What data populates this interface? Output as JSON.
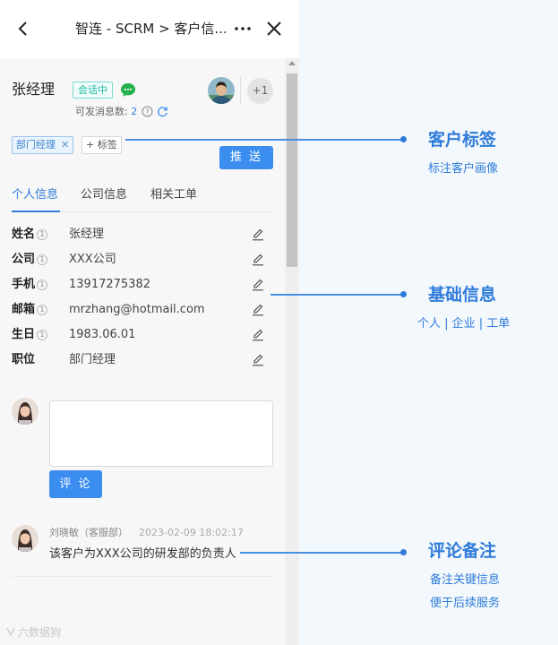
{
  "nav": {
    "title": "智连 - SCRM > 客户信..."
  },
  "customer": {
    "name": "张经理",
    "status_badge": "会话中",
    "message_count_label": "可发消息数:",
    "message_count": "2",
    "extra_members": "+1"
  },
  "tags": {
    "items": [
      {
        "label": "部门经理"
      }
    ],
    "add_label": "+ 标签",
    "push_label": "推 送"
  },
  "tabs": [
    {
      "label": "个人信息"
    },
    {
      "label": "公司信息"
    },
    {
      "label": "相关工单"
    }
  ],
  "fields": [
    {
      "label": "姓名",
      "badge": "1",
      "value": "张经理"
    },
    {
      "label": "公司",
      "badge": "1",
      "value": "XXX公司"
    },
    {
      "label": "手机",
      "badge": "1",
      "value": "13917275382"
    },
    {
      "label": "邮箱",
      "badge": "1",
      "value": "mrzhang@hotmail.com"
    },
    {
      "label": "生日",
      "badge": "1",
      "value": "1983.06.01"
    },
    {
      "label": "职位",
      "badge": "",
      "value": "部门经理"
    }
  ],
  "comment": {
    "input_value": "",
    "submit_label": "评 论"
  },
  "comments": [
    {
      "author": "刘晓敏（客服部）",
      "time": "2023-02-09 18:02:17",
      "text": "该客户为XXX公司的研发部的负责人"
    }
  ],
  "watermark": "六数据狗",
  "annotations": [
    {
      "title": "客户标签",
      "sub": [
        "标注客户画像"
      ]
    },
    {
      "title": "基础信息",
      "sub": [
        "个人 | 企业 | 工单"
      ]
    },
    {
      "title": "评论备注",
      "sub": [
        "备注关键信息",
        "便于后续服务"
      ]
    }
  ],
  "colors": {
    "accent": "#2f7bd9",
    "button": "#3b8ef0",
    "badge_teal": "#1fb8a6",
    "wechat_green": "#22b14c"
  }
}
